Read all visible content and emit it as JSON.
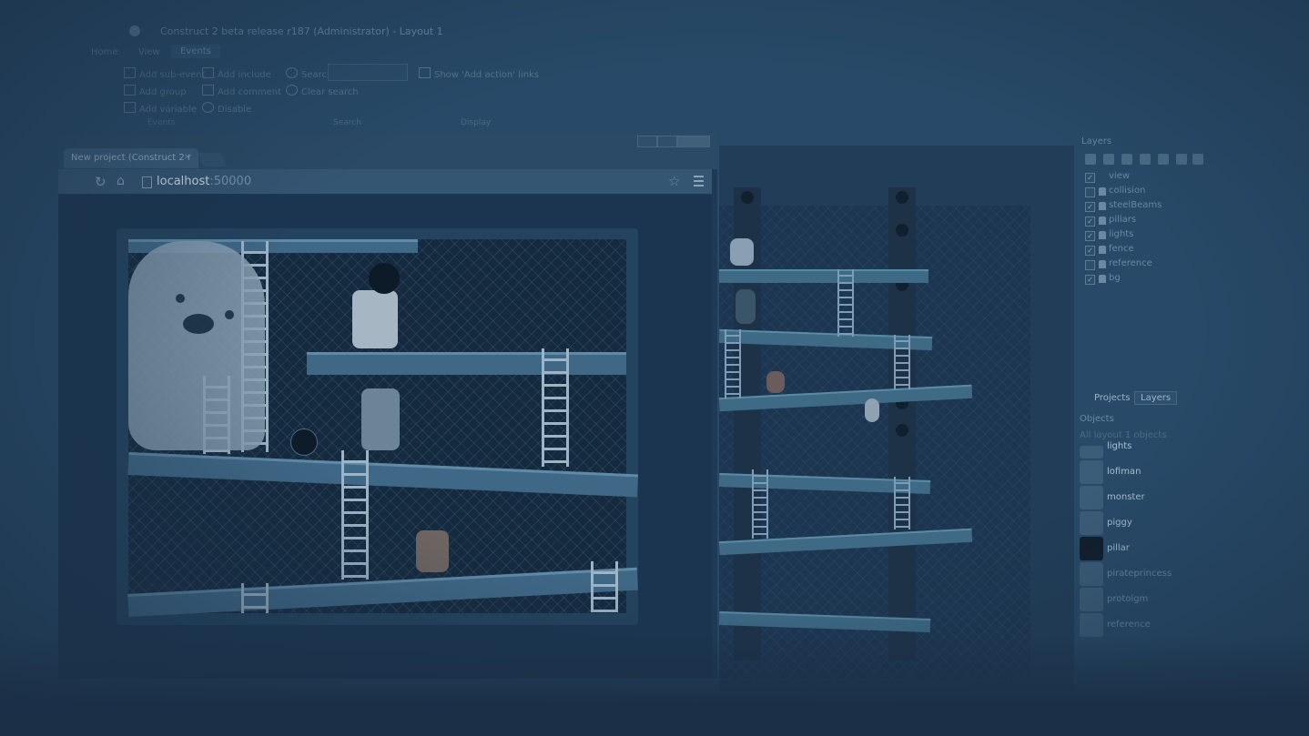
{
  "editor": {
    "window_title": "Construct 2 beta release r187 (Administrator) - Layout 1",
    "menu": [
      "Home",
      "View",
      "Events"
    ],
    "ribbon": {
      "add_sub_event": "Add sub-event",
      "add_group": "Add group",
      "add_variable": "Add variable",
      "add_include": "Add include",
      "add_comment": "Add comment",
      "disable": "Disable",
      "search": "Search",
      "clear_search": "Clear search",
      "show_add_action_links": "Show 'Add action' links",
      "group_events": "Events",
      "group_search": "Search",
      "group_display": "Display"
    },
    "layers": {
      "title": "Layers",
      "items": [
        {
          "name": "view",
          "checked": true,
          "locked": false
        },
        {
          "name": "collision",
          "checked": false,
          "locked": true
        },
        {
          "name": "steelBeams",
          "checked": true,
          "locked": true
        },
        {
          "name": "pillars",
          "checked": true,
          "locked": true
        },
        {
          "name": "lights",
          "checked": true,
          "locked": true
        },
        {
          "name": "fence",
          "checked": true,
          "locked": true
        },
        {
          "name": "reference",
          "checked": false,
          "locked": true
        },
        {
          "name": "bg",
          "checked": true,
          "locked": true
        }
      ]
    },
    "panel_tabs": {
      "projects": "Projects",
      "layers": "Layers"
    },
    "objects": {
      "title": "Objects",
      "filter": "All layout 1 objects",
      "items": [
        "lights",
        "lofiman",
        "monster",
        "piggy",
        "pillar",
        "pirateprincess",
        "protolgm",
        "reference"
      ]
    }
  },
  "browser": {
    "tab_title": "New project (Construct 2 r",
    "tab_close": "×",
    "address_host": "localhost",
    "address_port": ":50000",
    "reload_glyph": "↻",
    "home_glyph": "⌂",
    "star_glyph": "☆"
  }
}
